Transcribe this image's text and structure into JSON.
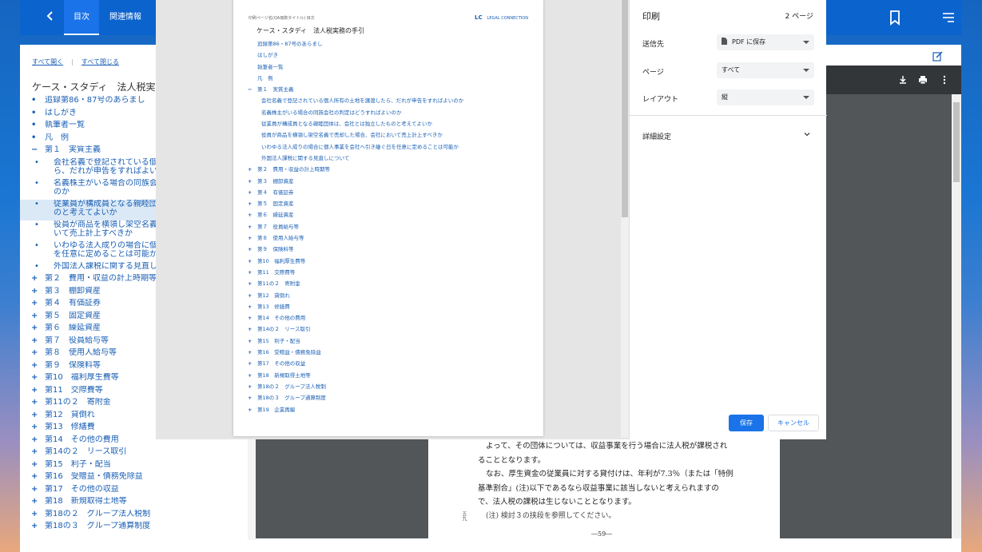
{
  "header": {
    "back_icon": "chevron-left-icon",
    "tabs": [
      {
        "label": "目次",
        "active": true
      },
      {
        "label": "関連情報",
        "active": false
      }
    ],
    "bookmark_icon": "bookmark-icon",
    "menu_icon": "menu-icon"
  },
  "left_panel": {
    "expand_all": "すべて開く",
    "collapse_all": "すべて閉じる",
    "title": "ケース・スタディ　法人税実務の手",
    "items": [
      {
        "marker": "•",
        "text": "追録第86・87号のあらまし",
        "sub": false
      },
      {
        "marker": "•",
        "text": "はしがき",
        "sub": false
      },
      {
        "marker": "•",
        "text": "執筆者一覧",
        "sub": false
      },
      {
        "marker": "•",
        "text": "凡　例",
        "sub": false
      },
      {
        "marker": "−",
        "text": "第１　実質主義",
        "sub": false
      },
      {
        "marker": "•",
        "text": "会社名義で登記されている個人所",
        "text2": "ら、だれが申告をすればよいのか",
        "sub": true
      },
      {
        "marker": "•",
        "text": "名義株主がいる場合の同族会社の",
        "text2": "のか",
        "sub": true
      },
      {
        "marker": "•",
        "text": "従業員が構成員となる親睦団体は",
        "text2": "のと考えてよいか",
        "sub": true,
        "selected": true
      },
      {
        "marker": "•",
        "text": "役員が商品を横領し架空名義で売",
        "text2": "いて売上計上すべきか",
        "sub": true
      },
      {
        "marker": "•",
        "text": "いわゆる法人成りの場合に個人事",
        "text2": "を任意に定めることは可能か",
        "sub": true
      },
      {
        "marker": "•",
        "text": "外国法人課税に関する見直しにつ",
        "sub": true
      },
      {
        "marker": "+",
        "text": "第２　費用・収益の計上時期等",
        "sub": false
      },
      {
        "marker": "+",
        "text": "第３　棚卸資産",
        "sub": false
      },
      {
        "marker": "+",
        "text": "第４　有価証券",
        "sub": false
      },
      {
        "marker": "+",
        "text": "第５　固定資産",
        "sub": false
      },
      {
        "marker": "+",
        "text": "第６　繰延資産",
        "sub": false
      },
      {
        "marker": "+",
        "text": "第７　役員給与等",
        "sub": false
      },
      {
        "marker": "+",
        "text": "第８　使用人給与等",
        "sub": false
      },
      {
        "marker": "+",
        "text": "第９　保険料等",
        "sub": false
      },
      {
        "marker": "+",
        "text": "第10　福利厚生費等",
        "sub": false
      },
      {
        "marker": "+",
        "text": "第11　交際費等",
        "sub": false
      },
      {
        "marker": "+",
        "text": "第11の２　寄附金",
        "sub": false
      },
      {
        "marker": "+",
        "text": "第12　貸倒れ",
        "sub": false
      },
      {
        "marker": "+",
        "text": "第13　修繕費",
        "sub": false
      },
      {
        "marker": "+",
        "text": "第14　その他の費用",
        "sub": false
      },
      {
        "marker": "+",
        "text": "第14の２　リース取引",
        "sub": false
      },
      {
        "marker": "+",
        "text": "第15　利子・配当",
        "sub": false
      },
      {
        "marker": "+",
        "text": "第16　受贈益・債務免除益",
        "sub": false
      },
      {
        "marker": "+",
        "text": "第17　その他の収益",
        "sub": false
      },
      {
        "marker": "+",
        "text": "第18　新規取得土地等",
        "sub": false
      },
      {
        "marker": "+",
        "text": "第18の２　グループ法人税制",
        "sub": false
      },
      {
        "marker": "+",
        "text": "第18の３　グループ通算制度",
        "sub": false
      }
    ]
  },
  "document": {
    "edit_icon": "edit-icon",
    "viewer_icons": [
      "download-icon",
      "print-icon",
      "more-vert-icon"
    ],
    "paragraphs": [
      "よって、その団体については、収益事業を行う場合に法人税が課税されることとなります。",
      "なお、厚生資金の従業員に対する貸付けは、年利が7.3％（または「特例基準割合」(注)以下であるなら収益事業に該当しないと考えられますので、法人税の課税は生じないこととなります。"
    ],
    "note": "(注) 検討３の挟段を参照してください。",
    "margin_mark": "五九",
    "page_number": "―59―"
  },
  "print_preview": {
    "header_left": "印刷ページ名(QA冊数タイトル) 目次",
    "brand_mark": "LC",
    "brand_name": "LEGAL CONNECTION",
    "title": "ケース・スタディ　法人税実務の手引",
    "rows": [
      {
        "marker": "",
        "text": "追録第86・87号のあらまし",
        "sub": false
      },
      {
        "marker": "",
        "text": "はしがき",
        "sub": false
      },
      {
        "marker": "",
        "text": "執筆者一覧",
        "sub": false
      },
      {
        "marker": "",
        "text": "凡　例",
        "sub": false
      },
      {
        "marker": "−",
        "text": "第１　実質主義",
        "sub": false
      },
      {
        "marker": "",
        "text": "会社名義で登記されている個人所有の土地を譲渡したら、だれが申告をすればよいのか",
        "sub": true
      },
      {
        "marker": "",
        "text": "名義株主がいる場合の同族会社の判定はどうすればよいのか",
        "sub": true
      },
      {
        "marker": "",
        "text": "従業員が構成員となる親睦団体は、会社とは独立したものと考えてよいか",
        "sub": true
      },
      {
        "marker": "",
        "text": "役員が商品を横領し架空名義で売却した場合、会社において売上計上すべきか",
        "sub": true
      },
      {
        "marker": "",
        "text": "いわゆる法人成りの場合に個人事業を会社へ引き継ぐ日を任意に定めることは可能か",
        "sub": true
      },
      {
        "marker": "",
        "text": "外国法人課税に関する見直しについて",
        "sub": true
      },
      {
        "marker": "+",
        "text": "第２　費用・収益の計上時期等",
        "sub": false
      },
      {
        "marker": "+",
        "text": "第３　棚卸資産",
        "sub": false
      },
      {
        "marker": "+",
        "text": "第４　有価証券",
        "sub": false
      },
      {
        "marker": "+",
        "text": "第５　固定資産",
        "sub": false
      },
      {
        "marker": "+",
        "text": "第６　繰延資産",
        "sub": false
      },
      {
        "marker": "+",
        "text": "第７　役員給与等",
        "sub": false
      },
      {
        "marker": "+",
        "text": "第８　使用人給与等",
        "sub": false
      },
      {
        "marker": "+",
        "text": "第９　保険料等",
        "sub": false
      },
      {
        "marker": "+",
        "text": "第10　福利厚生費等",
        "sub": false
      },
      {
        "marker": "+",
        "text": "第11　交際費等",
        "sub": false
      },
      {
        "marker": "+",
        "text": "第11の２　寄附金",
        "sub": false
      },
      {
        "marker": "+",
        "text": "第12　貸倒れ",
        "sub": false
      },
      {
        "marker": "+",
        "text": "第13　修繕費",
        "sub": false
      },
      {
        "marker": "+",
        "text": "第14　その他の費用",
        "sub": false
      },
      {
        "marker": "+",
        "text": "第14の２　リース取引",
        "sub": false
      },
      {
        "marker": "+",
        "text": "第15　利子・配当",
        "sub": false
      },
      {
        "marker": "+",
        "text": "第16　受贈益・債務免除益",
        "sub": false
      },
      {
        "marker": "+",
        "text": "第17　その他の収益",
        "sub": false
      },
      {
        "marker": "+",
        "text": "第18　新規取得土地等",
        "sub": false
      },
      {
        "marker": "+",
        "text": "第18の２　グループ法人税制",
        "sub": false
      },
      {
        "marker": "+",
        "text": "第18の３　グループ通算制度",
        "sub": false
      },
      {
        "marker": "+",
        "text": "第19　企業再編",
        "sub": false
      }
    ]
  },
  "print_settings": {
    "title": "印刷",
    "page_count": "2 ページ",
    "destination_label": "送信先",
    "destination_value": "PDF に保存",
    "pages_label": "ページ",
    "pages_value": "すべて",
    "layout_label": "レイアウト",
    "layout_value": "縦",
    "advanced_label": "詳細設定",
    "save_label": "保存",
    "cancel_label": "キャンセル",
    "accent_color": "#1a73e8"
  }
}
